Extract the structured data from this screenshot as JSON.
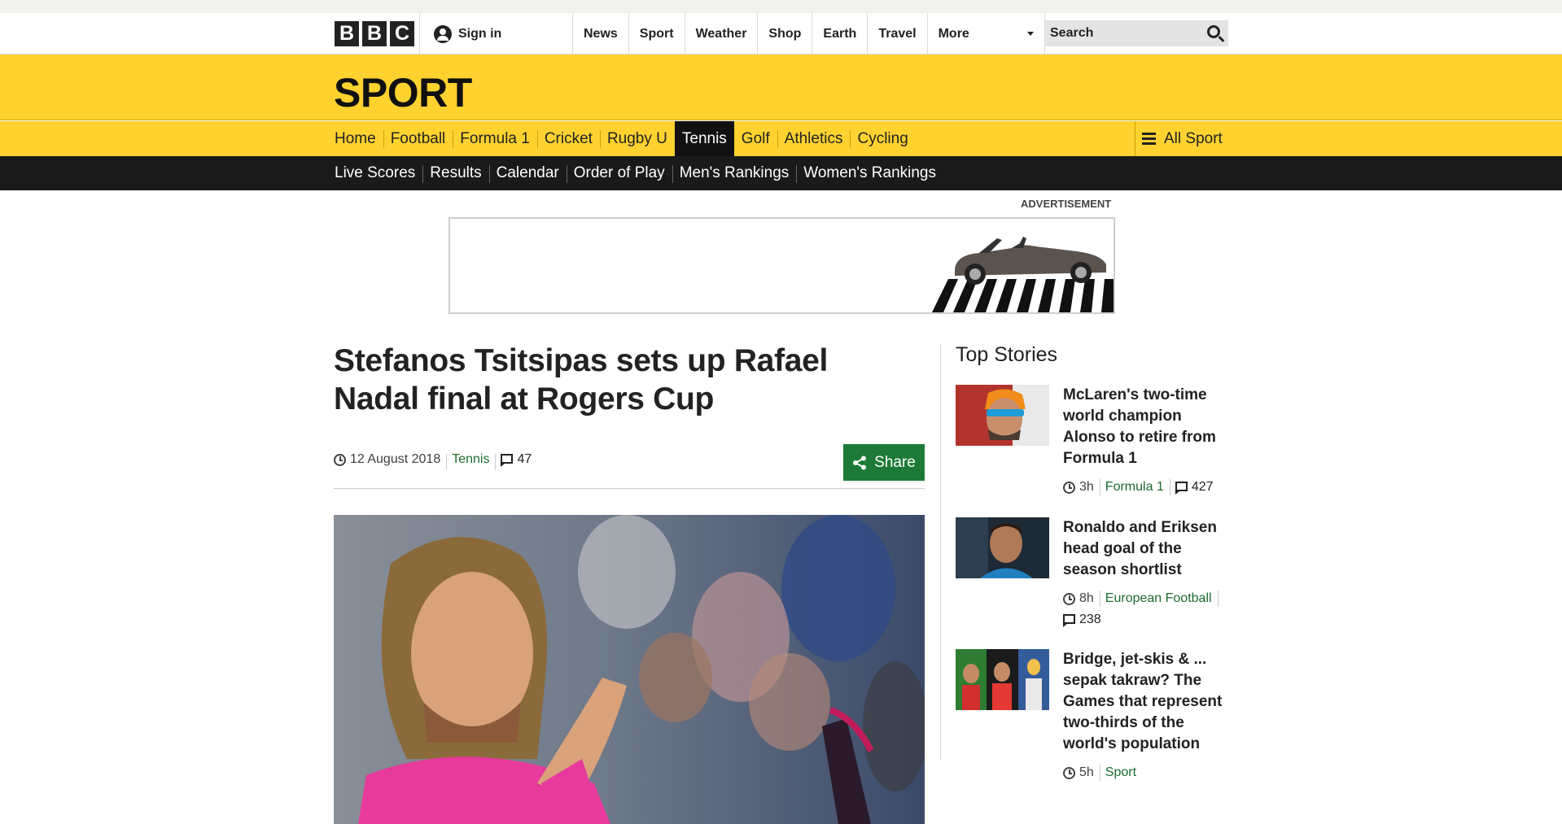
{
  "global_nav": {
    "logo_letters": [
      "B",
      "B",
      "C"
    ],
    "sign_in": "Sign in",
    "items": [
      "News",
      "Sport",
      "Weather",
      "Shop",
      "Earth",
      "Travel"
    ],
    "more": "More",
    "search_placeholder": "Search"
  },
  "masthead": {
    "title": "SPORT"
  },
  "sport_nav": {
    "items": [
      "Home",
      "Football",
      "Formula 1",
      "Cricket",
      "Rugby U",
      "Tennis",
      "Golf",
      "Athletics",
      "Cycling"
    ],
    "active": "Tennis",
    "all_sport": "All Sport"
  },
  "sub_nav": {
    "items": [
      "Live Scores",
      "Results",
      "Calendar",
      "Order of Play",
      "Men's Rankings",
      "Women's Rankings"
    ]
  },
  "advertisement": {
    "label": "ADVERTISEMENT"
  },
  "article": {
    "headline": "Stefanos Tsitsipas sets up Rafael Nadal final at Rogers Cup",
    "date": "12 August 2018",
    "section": "Tennis",
    "comments": "47",
    "share_label": "Share"
  },
  "top_stories": {
    "title": "Top Stories",
    "items": [
      {
        "title": "McLaren's two-time world champion Alonso to retire from Formula 1",
        "time": "3h",
        "section": "Formula 1",
        "comments": "427"
      },
      {
        "title": "Ronaldo and Eriksen head goal of the season shortlist",
        "time": "8h",
        "section": "European Football",
        "comments": "238"
      },
      {
        "title": "Bridge, jet-skis & ... sepak takraw? The Games that represent two-thirds of the world's population",
        "time": "5h",
        "section": "Sport"
      }
    ]
  },
  "colors": {
    "sport_yellow": "#ffd230",
    "nav_dark": "#1a1a1a",
    "link_green": "#1d6b2f",
    "share_green": "#1d7a36"
  }
}
